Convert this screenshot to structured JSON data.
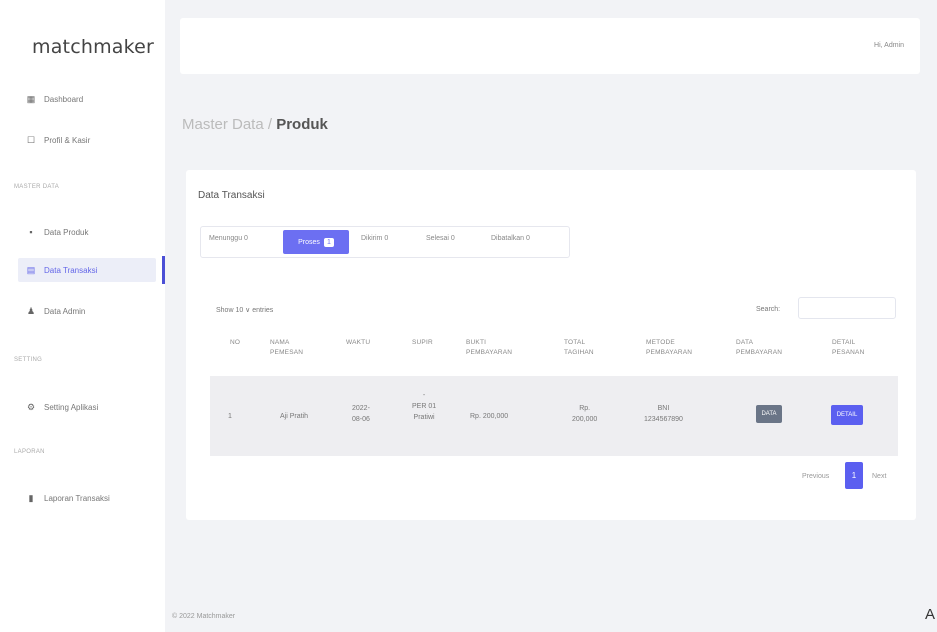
{
  "app": {
    "brand": "matchmaker"
  },
  "sidebar": {
    "items": [
      {
        "label": "Dashboard",
        "icon": "dashboard-icon",
        "glyph": "▦"
      },
      {
        "label": "Profil & Kasir",
        "icon": "user-card-icon",
        "glyph": "☐"
      },
      {
        "section": "MASTER DATA"
      },
      {
        "label": "Data Produk",
        "icon": "box-icon",
        "glyph": "▪"
      },
      {
        "label": "Data Transaksi",
        "icon": "cart-icon",
        "glyph": "▤",
        "active": true
      },
      {
        "label": "Data Admin",
        "icon": "users-icon",
        "glyph": "♟"
      },
      {
        "section": "SETTING"
      },
      {
        "label": "Setting Aplikasi",
        "icon": "settings-icon",
        "glyph": "⚙"
      },
      {
        "section": "LAPORAN"
      },
      {
        "label": "Laporan Transaksi",
        "icon": "report-icon",
        "glyph": "▮"
      }
    ]
  },
  "topbar": {
    "user": "Hi, Admin"
  },
  "breadcrumb": {
    "parent": "Master Data / ",
    "current": "Produk"
  },
  "card": {
    "title": "Data Transaksi",
    "tabs": [
      {
        "label": "Menunggu 0"
      },
      {
        "label": "Proses",
        "badge": "1",
        "active": true
      },
      {
        "label": "Dikirim 0"
      },
      {
        "label": "Selesai 0"
      },
      {
        "label": "Dibatalkan 0"
      }
    ],
    "show_entries": "Show 10 ∨ entries",
    "search_label": "Search:",
    "search_value": "",
    "columns": [
      [
        "NO"
      ],
      [
        "NAMA",
        "PEMESAN"
      ],
      [
        "WAKTU"
      ],
      [
        "SUPIR"
      ],
      [
        "BUKTI",
        "PEMBAYARAN"
      ],
      [
        "TOTAL",
        "TAGIHAN"
      ],
      [
        "METODE",
        "PEMBAYARAN"
      ],
      [
        "DATA",
        "PEMBAYARAN"
      ],
      [
        "DETAIL",
        "PESANAN"
      ]
    ],
    "row": {
      "no": "1",
      "nama": "Aji Pratih",
      "waktu": [
        "2022-",
        "08-06"
      ],
      "supir": [
        "-",
        "PER 01",
        "Pratiwi"
      ],
      "bukti": "Rp. 200,000",
      "total": [
        "Rp.",
        "200,000"
      ],
      "metode": [
        "BNI",
        "1234567890"
      ],
      "data_btn": "DATA",
      "detail_btn": "DETAIL"
    },
    "pager": {
      "prev": "Previous",
      "page": "1",
      "next": "Next"
    }
  },
  "footer": {
    "text": "© 2022 Matchmaker"
  },
  "corner": {
    "text": "A"
  },
  "colors": {
    "accent": "#5b5ff0",
    "gray_button": "#6a7587",
    "background": "#f2f3f6"
  }
}
